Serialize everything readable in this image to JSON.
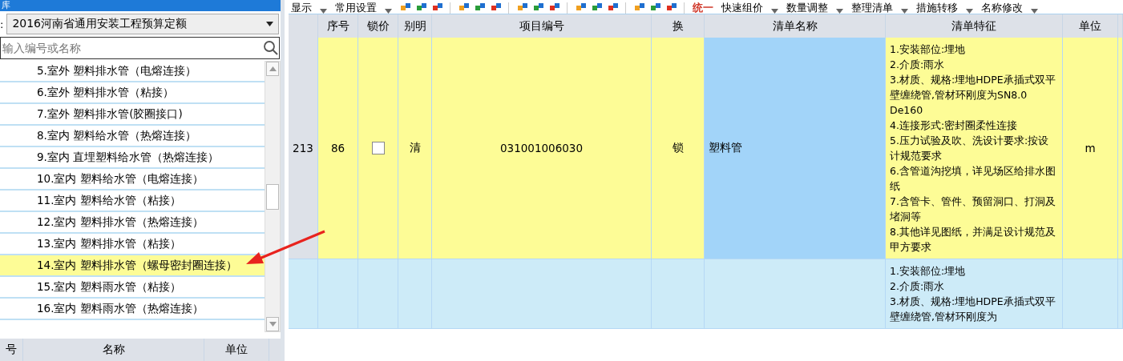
{
  "library_panel": {
    "title": "库",
    "library_label": ":",
    "library_select": "2016河南省通用安装工程预算定额",
    "search": {
      "placeholder": "输入编号或名称"
    },
    "items": [
      {
        "label": "5.室外 塑料排水管（电熔连接）",
        "selected": false
      },
      {
        "label": "6.室外 塑料排水管（粘接）",
        "selected": false
      },
      {
        "label": "7.室外 塑料排水管(胶圈接口)",
        "selected": false
      },
      {
        "label": "8.室内 塑料给水管（热熔连接）",
        "selected": false
      },
      {
        "label": "9.室内 直埋塑料给水管（热熔连接）",
        "selected": false
      },
      {
        "label": "10.室内 塑料给水管（电熔连接）",
        "selected": false
      },
      {
        "label": "11.室内 塑料给水管（粘接）",
        "selected": false
      },
      {
        "label": "12.室内 塑料排水管（热熔连接）",
        "selected": false
      },
      {
        "label": "13.室内 塑料排水管（粘接）",
        "selected": false
      },
      {
        "label": "14.室内 塑料排水管（螺母密封圈连接）",
        "selected": true
      },
      {
        "label": "15.室内 塑料雨水管（粘接）",
        "selected": false
      },
      {
        "label": "16.室内 塑料雨水管（热熔连接）",
        "selected": false
      }
    ],
    "lower_columns": [
      "号",
      "名称",
      "单位"
    ]
  },
  "toolbar": [
    {
      "kind": "menu",
      "label": "显示"
    },
    {
      "kind": "menu",
      "label": "常用设置"
    },
    {
      "kind": "icons"
    },
    {
      "kind": "icons"
    },
    {
      "kind": "icons"
    },
    {
      "kind": "icons"
    },
    {
      "kind": "icons"
    },
    {
      "kind": "text",
      "label": "统一"
    },
    {
      "kind": "menu",
      "label": "快速组价"
    },
    {
      "kind": "menu",
      "label": "数量调整"
    },
    {
      "kind": "menu",
      "label": "整理清单"
    },
    {
      "kind": "menu",
      "label": "措施转移"
    },
    {
      "kind": "menu",
      "label": "名称修改"
    }
  ],
  "table": {
    "columns": [
      "",
      "序号",
      "锁价",
      "别明",
      "项目编号",
      "换",
      "清单名称",
      "清单特征",
      "单位"
    ],
    "rows": [
      {
        "row_number": "213",
        "seq": "86",
        "lock_price": false,
        "type": "清",
        "code": "031001006030",
        "swap": "锁",
        "name": "塑料管",
        "features": [
          "1.安装部位:埋地",
          "2.介质:雨水",
          "3.材质、规格:埋地HDPE承插式双平壁缠绕管,管材环刚度为SN8.0 De160",
          "4.连接形式:密封圈柔性连接",
          "5.压力试验及吹、洗设计要求:按设计规范要求",
          "6.含管道沟挖填，详见场区给排水图纸",
          "7.含管卡、管件、预留洞口、打洞及堵洞等",
          "8.其他详见图纸，并满足设计规范及甲方要求"
        ],
        "unit": "m",
        "selected": true
      },
      {
        "row_number": "",
        "seq": "",
        "lock_price": null,
        "type": "",
        "code": "",
        "swap": "",
        "name": "",
        "features": [
          "1.安装部位:埋地",
          "2.介质:雨水",
          "3.材质、规格:埋地HDPE承插式双平壁缠绕管,管材环刚度为"
        ],
        "unit": "",
        "selected": false
      }
    ]
  }
}
